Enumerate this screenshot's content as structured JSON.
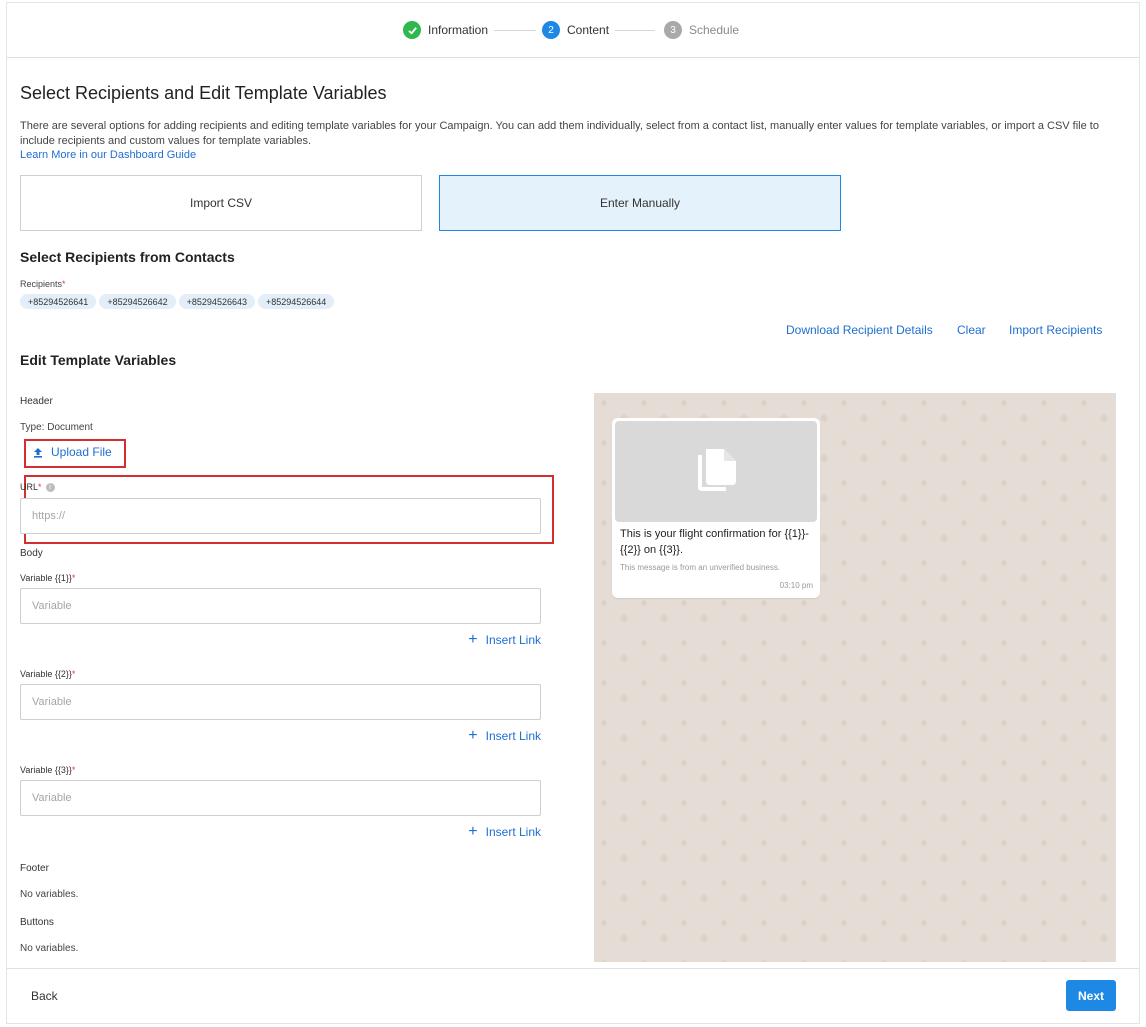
{
  "stepper": {
    "steps": [
      {
        "label": "Information",
        "status": "done"
      },
      {
        "label": "Content",
        "number": "2",
        "status": "active"
      },
      {
        "label": "Schedule",
        "number": "3",
        "status": "todo"
      }
    ]
  },
  "page": {
    "title": "Select Recipients and Edit Template Variables",
    "description": "There are several options for adding recipients and editing template variables for your Campaign. You can add them individually, select from a contact list, manually enter values for template variables, or import a CSV file to include recipients and custom values for template variables.",
    "guide_link": "Learn More in our Dashboard Guide"
  },
  "options": {
    "import_csv": "Import CSV",
    "enter_manually": "Enter Manually"
  },
  "recipients": {
    "heading": "Select Recipients from Contacts",
    "label": "Recipients",
    "required_mark": "*",
    "chips": [
      "+85294526641",
      "+85294526642",
      "+85294526643",
      "+85294526644"
    ],
    "download": "Download Recipient Details",
    "clear": "Clear",
    "import": "Import Recipients"
  },
  "template": {
    "heading": "Edit Template Variables",
    "header_label": "Header",
    "header_type": "Type: Document",
    "upload_label": "Upload File",
    "url_label": "URL",
    "url_placeholder": "https://",
    "body_label": "Body",
    "variables": [
      {
        "label": "Variable {{1}}",
        "placeholder": "Variable"
      },
      {
        "label": "Variable {{2}}",
        "placeholder": "Variable"
      },
      {
        "label": "Variable {{3}}",
        "placeholder": "Variable"
      }
    ],
    "insert_link": "Insert Link",
    "footer_label": "Footer",
    "footer_value": "No variables.",
    "buttons_label": "Buttons",
    "buttons_value": "No variables."
  },
  "preview": {
    "message": "This is your flight confirmation for {{1}}-{{2}} on {{3}}.",
    "note": "This message is from an unverified business.",
    "time": "03:10 pm"
  },
  "nav": {
    "back": "Back",
    "next": "Next"
  },
  "colors": {
    "accent": "#1e88e5",
    "done": "#2eb84e",
    "highlight_box": "#d32f2f"
  }
}
